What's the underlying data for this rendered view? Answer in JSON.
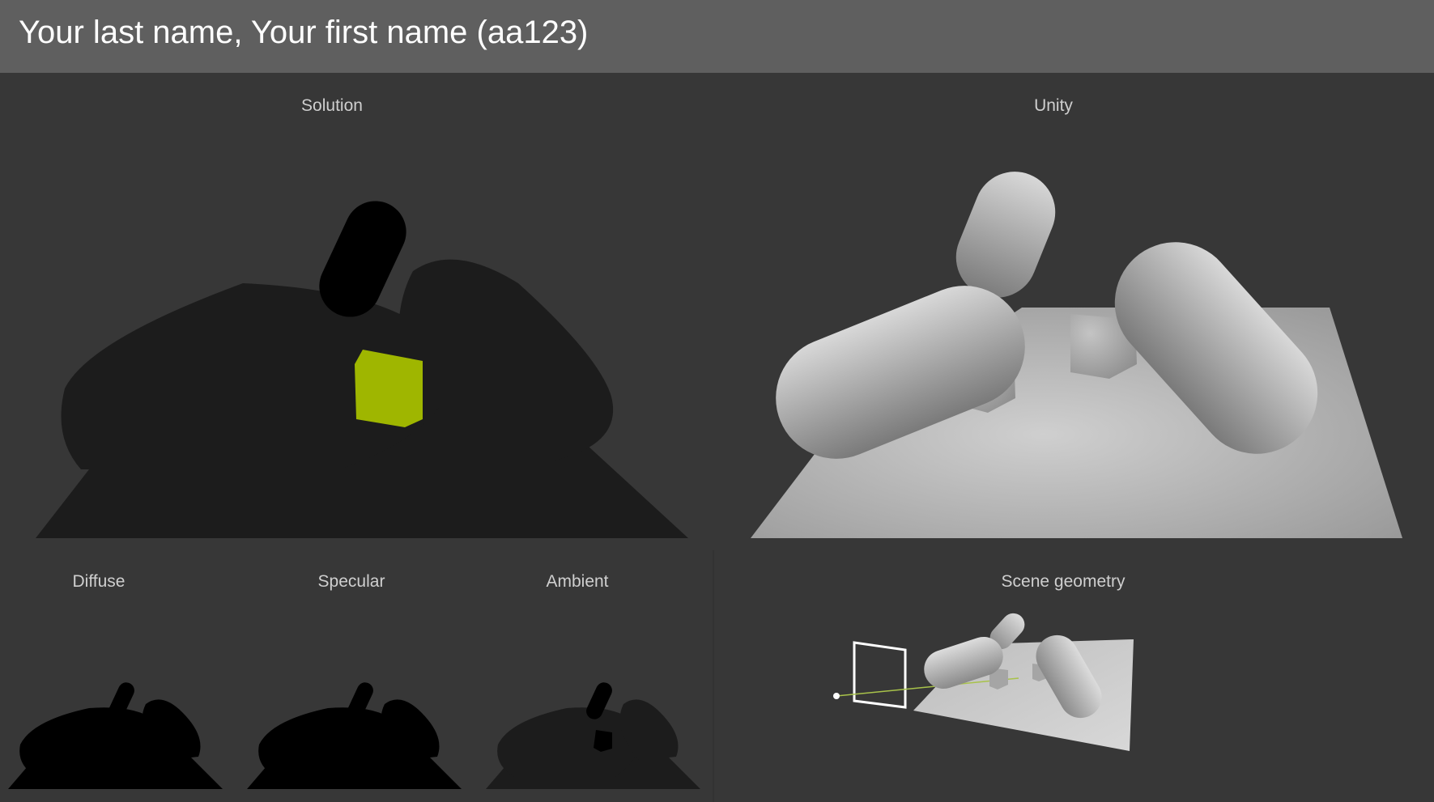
{
  "header": {
    "title": "Your last name, Your first name (aa123)"
  },
  "panels": {
    "solution": {
      "label": "Solution"
    },
    "unity": {
      "label": "Unity"
    },
    "diffuse": {
      "label": "Diffuse"
    },
    "specular": {
      "label": "Specular"
    },
    "ambient": {
      "label": "Ambient"
    },
    "scene_geometry": {
      "label": "Scene geometry"
    }
  },
  "colors": {
    "header_bg": "#5f5f5f",
    "page_bg": "#373737",
    "render_dark": "#1c1c1c",
    "cube_green": "#9fb600"
  }
}
